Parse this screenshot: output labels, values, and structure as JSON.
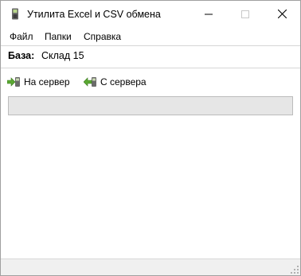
{
  "window": {
    "title": "Утилита Excel и CSV обмена"
  },
  "menu": {
    "items": [
      "Файл",
      "Папки",
      "Справка"
    ]
  },
  "database": {
    "label": "База:",
    "value": "Склад 15"
  },
  "toolbar": {
    "upload_label": "На сервер",
    "download_label": "С сервера"
  },
  "progress": {
    "value": 0
  },
  "icons": {
    "app": "phone-icon",
    "upload": "arrow-right-icon",
    "download": "arrow-left-icon",
    "minimize": "minimize-icon",
    "maximize": "maximize-icon",
    "close": "close-icon"
  },
  "colors": {
    "arrow": "#5aa832",
    "device": "#6b6b6b",
    "progress_track": "#e6e6e6"
  }
}
